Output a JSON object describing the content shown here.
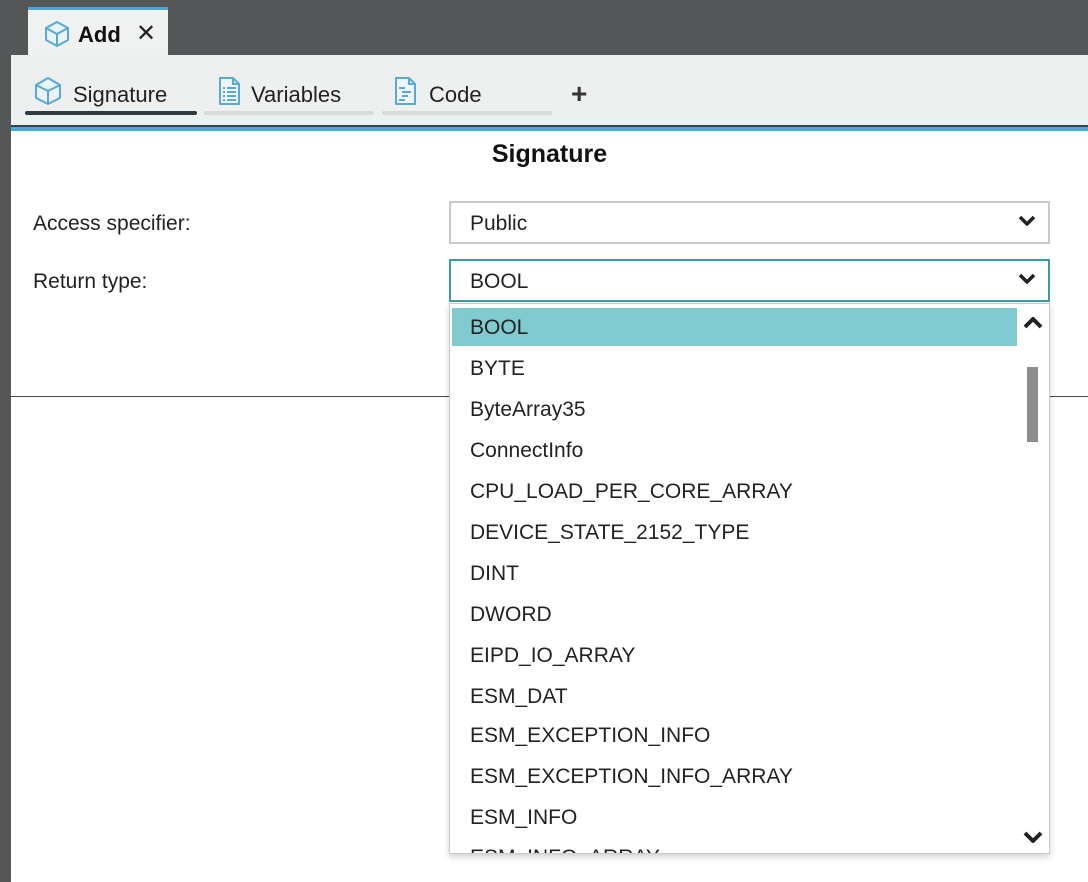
{
  "document_tab": {
    "title": "Add",
    "close_symbol": "✕",
    "icon": "cube-icon"
  },
  "subtabs": [
    {
      "label": "Signature",
      "icon": "cube-icon",
      "active": true
    },
    {
      "label": "Variables",
      "icon": "document-list-icon",
      "active": false
    },
    {
      "label": "Code",
      "icon": "code-document-icon",
      "active": false
    }
  ],
  "add_tab_symbol": "+",
  "heading": "Signature",
  "access_specifier": {
    "label": "Access specifier:",
    "value": "Public"
  },
  "return_type": {
    "label": "Return type:",
    "value": "BOOL"
  },
  "dropdown": {
    "options": [
      "BOOL",
      "BYTE",
      "ByteArray35",
      "ConnectInfo",
      "CPU_LOAD_PER_CORE_ARRAY",
      "DEVICE_STATE_2152_TYPE",
      "DINT",
      "DWORD",
      "EIPD_IO_ARRAY",
      "ESM_DAT",
      "ESM_EXCEPTION_INFO",
      "ESM_EXCEPTION_INFO_ARRAY",
      "ESM_INFO",
      "ESM_INFO_ARRAY"
    ],
    "selected": "BOOL"
  },
  "colors": {
    "frame": "#555658",
    "accent_blue": "#4aa8d8",
    "selection": "#80cbcf",
    "focus_border": "#3a9ba3"
  }
}
